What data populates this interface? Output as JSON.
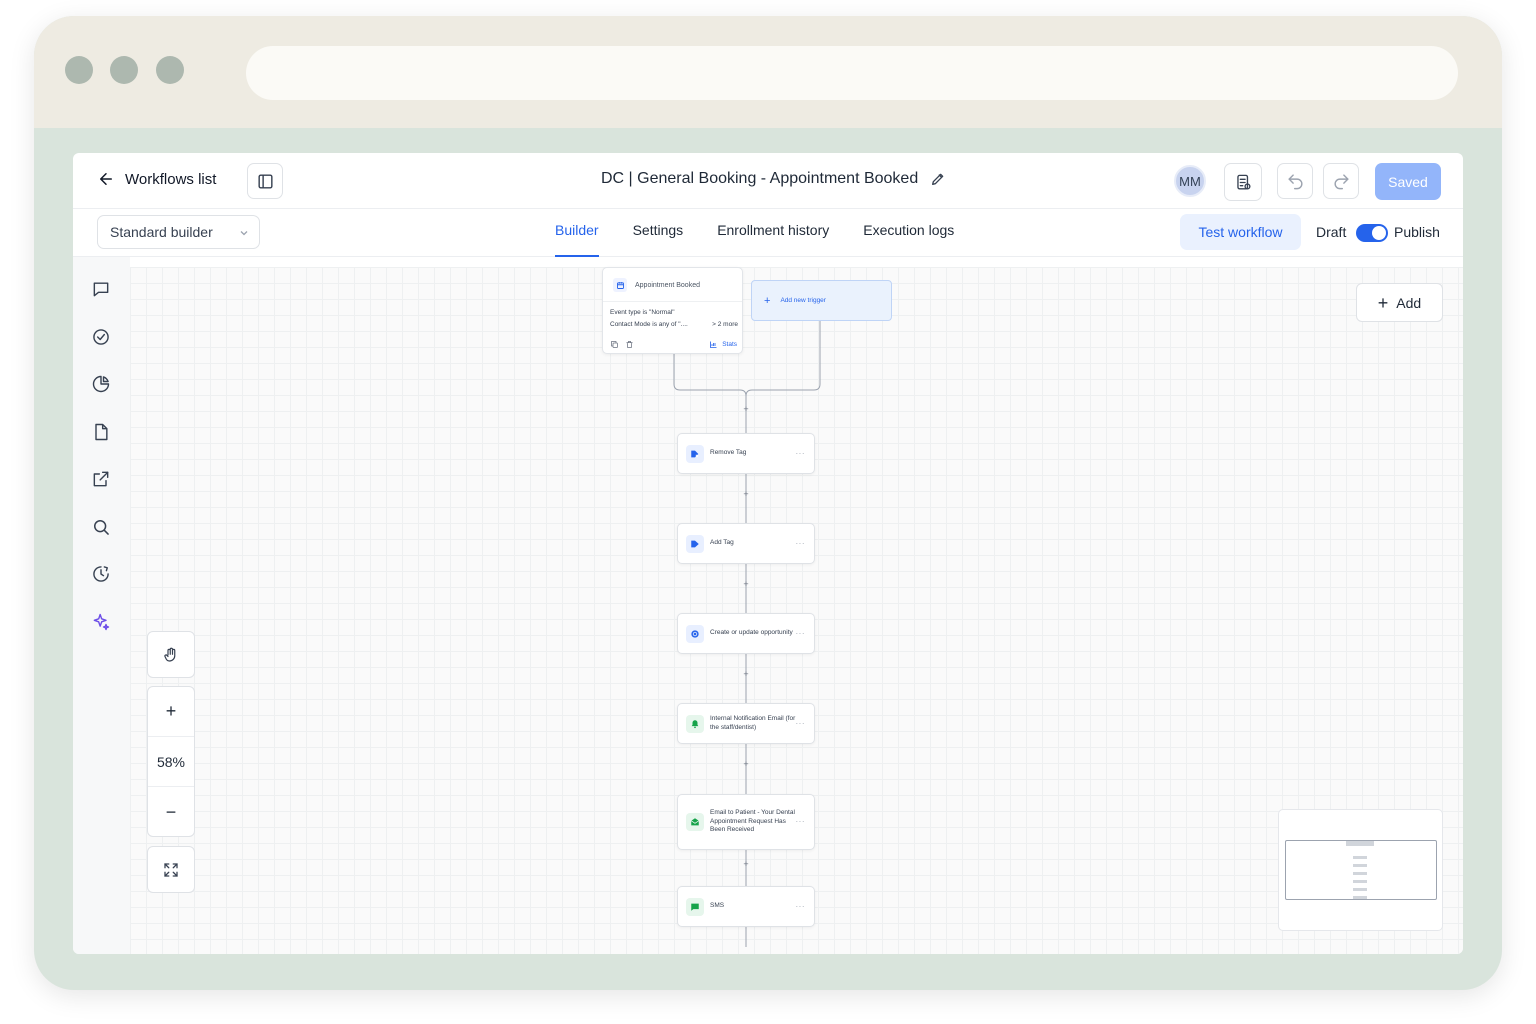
{
  "header": {
    "back_label": "Workflows list",
    "workflow_title": "DC | General Booking - Appointment Booked",
    "avatar_initials": "MM",
    "saved_label": "Saved"
  },
  "subbar": {
    "builder_select": "Standard builder",
    "tabs": [
      {
        "label": "Builder",
        "active": true
      },
      {
        "label": "Settings",
        "active": false
      },
      {
        "label": "Enrollment history",
        "active": false
      },
      {
        "label": "Execution logs",
        "active": false
      }
    ],
    "test_label": "Test workflow",
    "draft_label": "Draft",
    "publish_label": "Publish",
    "publish_on": true
  },
  "sidebar": {
    "icons": [
      "chat-icon",
      "check-circle-icon",
      "pie-chart-icon",
      "file-icon",
      "external-link-icon",
      "search-icon",
      "history-icon",
      "sparkles-icon"
    ]
  },
  "canvas": {
    "add_label": "Add",
    "zoom_level": "58%",
    "trigger": {
      "title": "Appointment Booked",
      "line1": "Event type is \"Normal\"",
      "line2": "Contact Mode is any of \"....",
      "more": "> 2 more",
      "stats_label": "Stats"
    },
    "add_trigger_label": "Add new trigger",
    "actions": [
      {
        "label": "Remove Tag",
        "icon": "tag-remove-icon",
        "color": "#2563eb"
      },
      {
        "label": "Add Tag",
        "icon": "tag-icon",
        "color": "#2563eb"
      },
      {
        "label": "Create or update opportunity",
        "icon": "target-icon",
        "color": "#2563eb"
      },
      {
        "label": "Internal Notification Email (for the staff/dentist)",
        "icon": "bell-icon",
        "color": "#16a34a"
      },
      {
        "label": "Email to Patient - Your Dental Appointment Request Has Been Received",
        "icon": "mail-icon",
        "color": "#16a34a"
      },
      {
        "label": "SMS",
        "icon": "message-icon",
        "color": "#16a34a"
      }
    ]
  },
  "colors": {
    "accent": "#2563eb",
    "saved_button": "#93b5fa",
    "frame": "#d9e4dc"
  }
}
